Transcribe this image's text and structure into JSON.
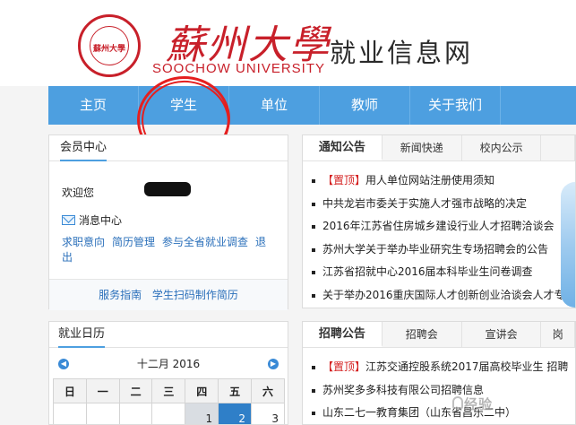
{
  "header": {
    "seal_text": "蘇州大學",
    "calligraphy": "蘇州大學",
    "university_en": "SOOCHOW UNIVERSITY",
    "site_name": "就业信息网"
  },
  "nav": {
    "items": [
      {
        "label": "主页"
      },
      {
        "label": "学生"
      },
      {
        "label": "单位"
      },
      {
        "label": "教师"
      },
      {
        "label": "关于我们"
      }
    ]
  },
  "member": {
    "title": "会员中心",
    "welcome": "欢迎您",
    "message_center": "消息中心",
    "links": [
      "求职意向",
      "简历管理",
      "参与全省就业调查",
      "退出"
    ],
    "services": [
      "服务指南",
      "学生扫码制作简历"
    ]
  },
  "calendar": {
    "title": "就业日历",
    "month_label": "十二月 2016",
    "weekdays": [
      "日",
      "一",
      "二",
      "三",
      "四",
      "五",
      "六"
    ],
    "first_row": [
      "",
      "",
      "",
      "",
      "1",
      "2",
      "3"
    ],
    "today": "2"
  },
  "notice": {
    "tabs": [
      "通知公告",
      "新闻快递",
      "校内公示",
      ""
    ],
    "items": [
      {
        "tag": "【置顶】",
        "text": "用人单位网站注册使用须知"
      },
      {
        "tag": "",
        "text": "中共龙岩市委关于实施人才强市战略的决定"
      },
      {
        "tag": "",
        "text": "2016年江苏省住房城乡建设行业人才招聘洽谈会"
      },
      {
        "tag": "",
        "text": "苏州大学关于举办毕业研究生专场招聘会的公告"
      },
      {
        "tag": "",
        "text": "江苏省招就中心2016届本科毕业生问卷调查"
      },
      {
        "tag": "",
        "text": "关于举办2016重庆国际人才创新创业洽谈会人才专"
      }
    ]
  },
  "recruit": {
    "tabs": [
      "招聘公告",
      "招聘会",
      "宣讲会",
      "岗"
    ],
    "items": [
      {
        "tag": "【置顶】",
        "text": "江苏交通控股系统2017届高校毕业生 招聘"
      },
      {
        "tag": "",
        "text": "苏州奖多多科技有限公司招聘信息"
      },
      {
        "tag": "",
        "text": "山东二七一教育集团（山东省昌乐二中）"
      }
    ]
  },
  "watermark": "经验"
}
